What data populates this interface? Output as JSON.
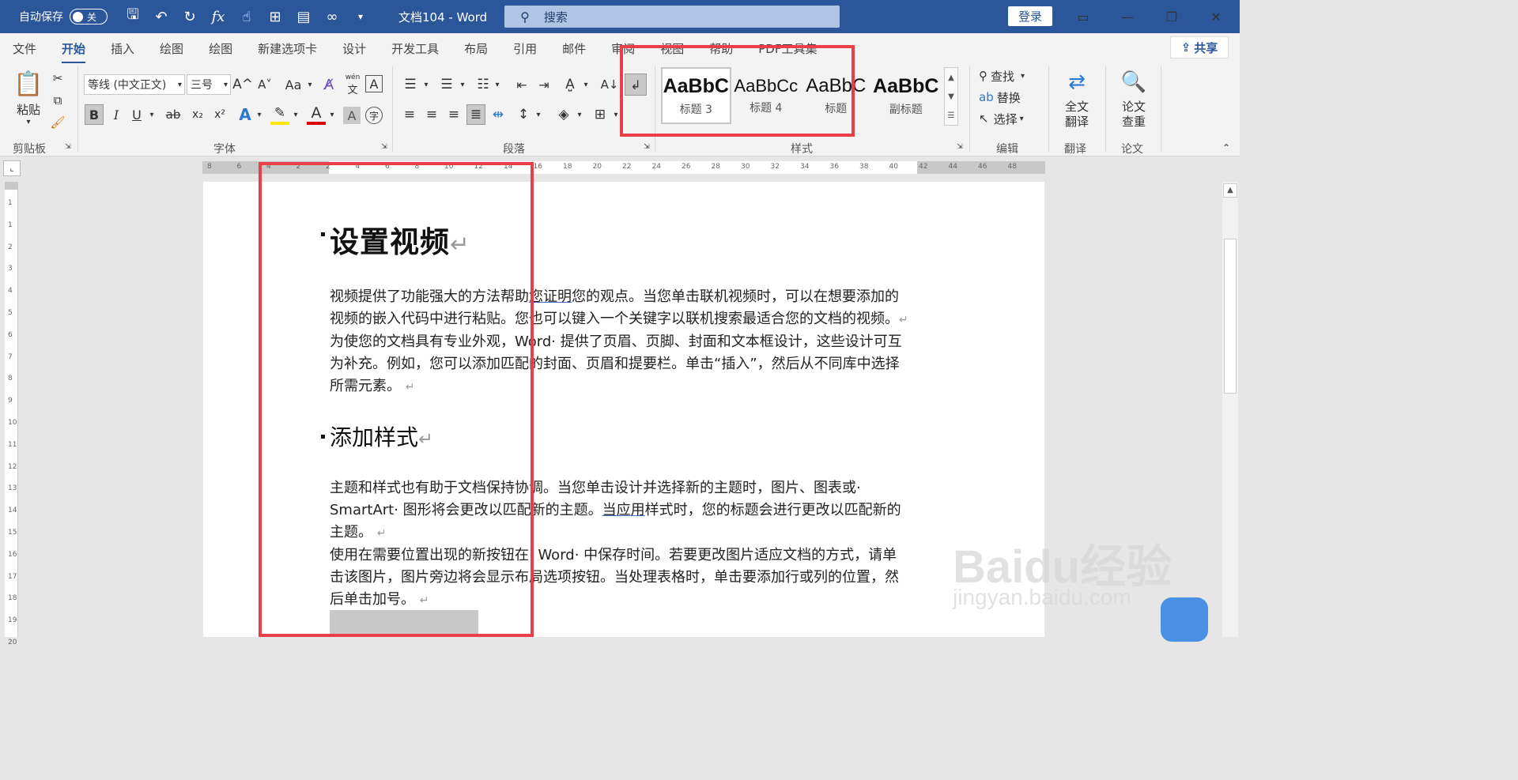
{
  "titlebar": {
    "autosave_label": "自动保存",
    "autosave_state": "关",
    "doc_title": "文档104  -  Word",
    "search_placeholder": "搜索",
    "login": "登录",
    "qa_fx": "fx"
  },
  "tabs": [
    "文件",
    "开始",
    "插入",
    "绘图",
    "绘图",
    "新建选项卡",
    "设计",
    "开发工具",
    "布局",
    "引用",
    "邮件",
    "审阅",
    "视图",
    "帮助",
    "PDF工具集"
  ],
  "share": "共享",
  "ribbon": {
    "clipboard": {
      "paste": "粘贴",
      "label": "剪贴板"
    },
    "font": {
      "face": "等线 (中文正文)",
      "size": "三号",
      "grow": "A^",
      "shrink": "A˅",
      "case": "Aa",
      "phonetic_top": "wén",
      "phonetic_bottom": "文",
      "bold": "B",
      "italic": "I",
      "underline": "U",
      "strike": "ab",
      "subscript": "x₂",
      "superscript": "x²",
      "label": "字体"
    },
    "paragraph": {
      "label": "段落"
    },
    "styles": {
      "items": [
        {
          "sample": "AaBbC",
          "name": "标题 3"
        },
        {
          "sample": "AaBbCc",
          "name": "标题 4"
        },
        {
          "sample": "AaBbC",
          "name": "标题"
        },
        {
          "sample": "AaBbC",
          "name": "副标题"
        }
      ],
      "label": "样式"
    },
    "editing": {
      "find": "查找",
      "replace": "替换",
      "select": "选择",
      "label": "编辑"
    },
    "translate": {
      "btn_line1": "全文",
      "btn_line2": "翻译",
      "label": "翻译"
    },
    "paper": {
      "btn_line1": "论文",
      "btn_line2": "查重",
      "label": "论文"
    }
  },
  "document": {
    "heading1": "设置视频",
    "para1": [
      [
        "视频提供了功能强大的方法帮助",
        "您证明",
        "您的观点。当您单击联机视频时，可以在想要添加的"
      ],
      [
        "视频的嵌入代码中进行粘贴。您也可以键入一个关键字以联机搜索最适合您的文档的视频。"
      ]
    ],
    "para2": [
      "为使您的文档具有专业外观，Word· 提供了页眉、页脚、封面和文本框设计，这些设计可互",
      "为补充。例如，您可以添加匹配的封面、页眉和提要栏。单击“插入”，然后从不同库中选择",
      "所需元素。"
    ],
    "heading2": "添加样式",
    "para3": [
      [
        "主题和样式也有助于文档保持协调。当您单击设计并选择新的主题时，图片、图表或·"
      ],
      [
        "SmartArt· 图形将会更改以匹配新的主题。",
        "当应用",
        "样式时，您的标题会进行更改以匹配新的"
      ],
      [
        "主题。"
      ]
    ],
    "para4": [
      "使用在需要位置出现的新按钮在· Word· 中保存时间。若要更改图片适应文档的方式，请单",
      "击该图片，图片旁边将会显示布局选项按钮。当处理表格时，单击要添加行或列的位置，然",
      "后单击加号。"
    ],
    "para_mark": "↵"
  },
  "ruler_numbers": [
    "8",
    "6",
    "4",
    "2",
    "2",
    "4",
    "6",
    "8",
    "10",
    "12",
    "14",
    "16",
    "18",
    "20",
    "22",
    "24",
    "26",
    "28",
    "30",
    "32",
    "34",
    "36",
    "38",
    "40",
    "42",
    "44",
    "46",
    "48"
  ],
  "vruler_numbers": [
    "1",
    "1",
    "2",
    "3",
    "4",
    "5",
    "6",
    "7",
    "8",
    "9",
    "10",
    "11",
    "12",
    "13",
    "14",
    "15",
    "16",
    "17",
    "18",
    "19",
    "20"
  ],
  "watermark": {
    "text": "Baidu经验",
    "sub": "jingyan.baidu.com"
  },
  "colors": {
    "titlebar": "#2b579a",
    "highlight": "#e8404a"
  }
}
